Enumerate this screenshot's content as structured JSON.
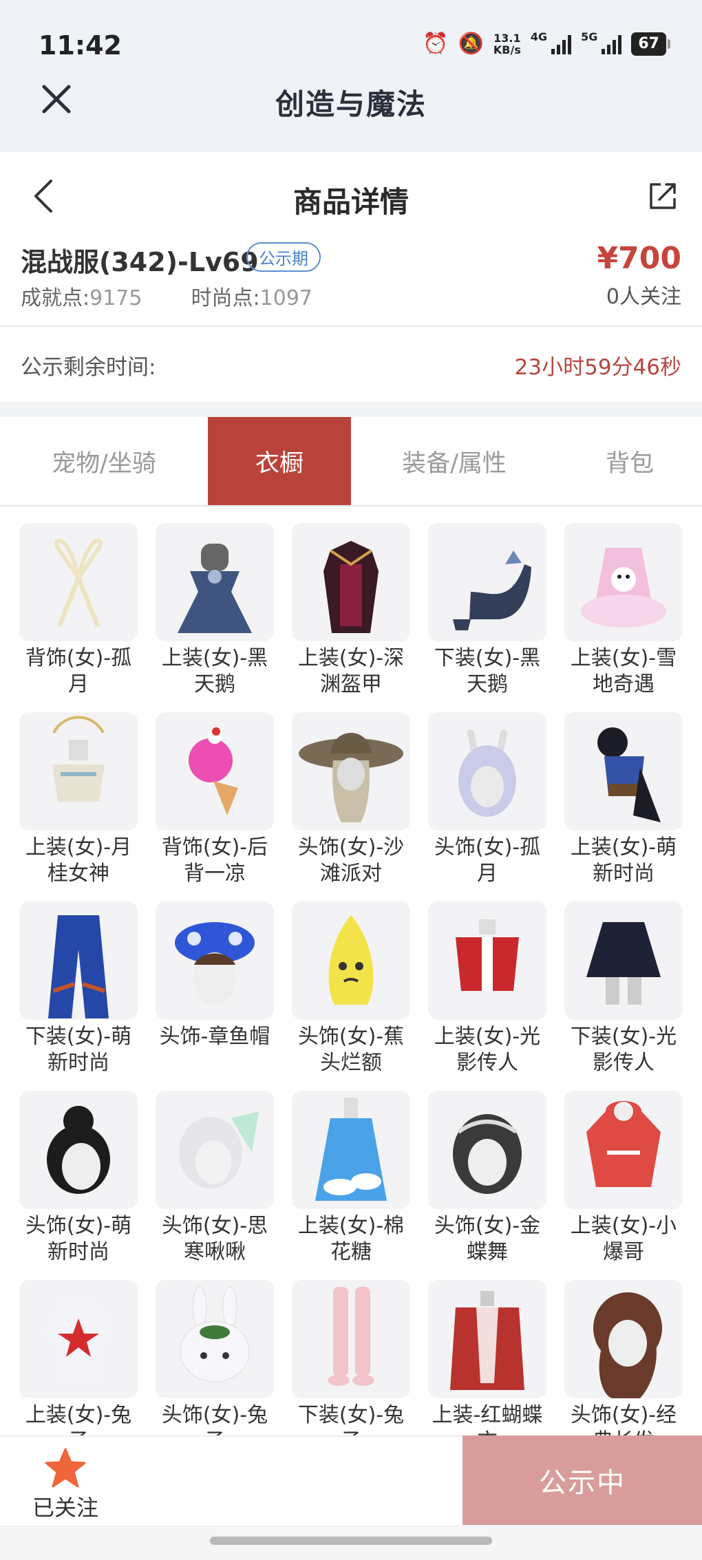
{
  "status_bar": {
    "time": "11:42",
    "net_speed_value": "13.1",
    "net_speed_unit": "KB/s",
    "signal_1_label": "4G",
    "signal_2_label": "5G",
    "battery": "67"
  },
  "app_bar": {
    "title": "创造与魔法"
  },
  "header": {
    "title": "商品详情"
  },
  "item": {
    "name": "混战服(342)-Lv69",
    "badge": "公示期",
    "price": "¥700",
    "watchers": "0人关注",
    "achievement_label": "成就点:",
    "achievement_value": "9175",
    "fashion_label": "时尚点:",
    "fashion_value": "1097"
  },
  "timer": {
    "label": "公示剩余时间:",
    "value": "23小时59分46秒"
  },
  "tabs": [
    {
      "label": "宠物/坐骑",
      "active": false
    },
    {
      "label": "衣橱",
      "active": true
    },
    {
      "label": "装备/属性",
      "active": false
    },
    {
      "label": "背包",
      "active": false
    }
  ],
  "wardrobe": [
    {
      "label": "背饰(女)-孤月",
      "icon": "ribbon-accessory",
      "color": "#efe4c2"
    },
    {
      "label": "上装(女)-黑天鹅",
      "icon": "dress-top",
      "color": "#3f5580"
    },
    {
      "label": "上装(女)-深渊盔甲",
      "icon": "armor-top",
      "color": "#8a2040"
    },
    {
      "label": "下装(女)-黑天鹅",
      "icon": "high-heel",
      "color": "#34405a"
    },
    {
      "label": "上装(女)-雪地奇遇",
      "icon": "fluffy-dress",
      "color": "#f2c0de"
    },
    {
      "label": "上装(女)-月桂女神",
      "icon": "goddess-top",
      "color": "#e7e2d2"
    },
    {
      "label": "背饰(女)-后背一凉",
      "icon": "ice-cream",
      "color": "#ec4fb1"
    },
    {
      "label": "头饰(女)-沙滩派对",
      "icon": "sun-hat",
      "color": "#7a6a55"
    },
    {
      "label": "头饰(女)-孤月",
      "icon": "bunny-hairpiece",
      "color": "#c9cbe8"
    },
    {
      "label": "上装(女)-萌新时尚",
      "icon": "blue-corset-top",
      "color": "#3452a8"
    },
    {
      "label": "下装(女)-萌新时尚",
      "icon": "blue-pants",
      "color": "#2447a8"
    },
    {
      "label": "头饰-章鱼帽",
      "icon": "octopus-hat",
      "color": "#2f56d6"
    },
    {
      "label": "头饰(女)-蕉头烂额",
      "icon": "banana-hat",
      "color": "#f3e34a"
    },
    {
      "label": "上装(女)-光影传人",
      "icon": "red-jacket",
      "color": "#c9282d"
    },
    {
      "label": "下装(女)-光影传人",
      "icon": "pleated-skirt",
      "color": "#1e2236"
    },
    {
      "label": "头饰(女)-萌新时尚",
      "icon": "black-bun-hair",
      "color": "#1c1c1c"
    },
    {
      "label": "头饰(女)-思寒啾啾",
      "icon": "twin-tail-hair",
      "color": "#bfe8d6"
    },
    {
      "label": "上装(女)-棉花糖",
      "icon": "cloud-dress",
      "color": "#4aa3e8"
    },
    {
      "label": "头饰(女)-金蝶舞",
      "icon": "jeweled-hair",
      "color": "#3a3a3a"
    },
    {
      "label": "上装(女)-小爆哥",
      "icon": "red-hoodie",
      "color": "#e04a44"
    },
    {
      "label": "上装(女)-兔子",
      "icon": "white-onesie",
      "color": "#f4f4f8"
    },
    {
      "label": "头饰(女)-兔子",
      "icon": "bunny-head",
      "color": "#f7f7fb"
    },
    {
      "label": "下装(女)-兔子",
      "icon": "pink-boots",
      "color": "#f2c3c8"
    },
    {
      "label": "上装-红蝴蝶衣",
      "icon": "butterfly-top",
      "color": "#b8322e"
    },
    {
      "label": "头饰(女)-经典长发",
      "icon": "long-hair",
      "color": "#6a3a2a"
    }
  ],
  "bottom": {
    "follow_label": "已关注",
    "cta_label": "公示中"
  },
  "colors": {
    "accent": "#b9433a",
    "price": "#c5453c",
    "cta": "#d89d9a",
    "star": "#f0653a",
    "badge": "#4a82c8"
  }
}
